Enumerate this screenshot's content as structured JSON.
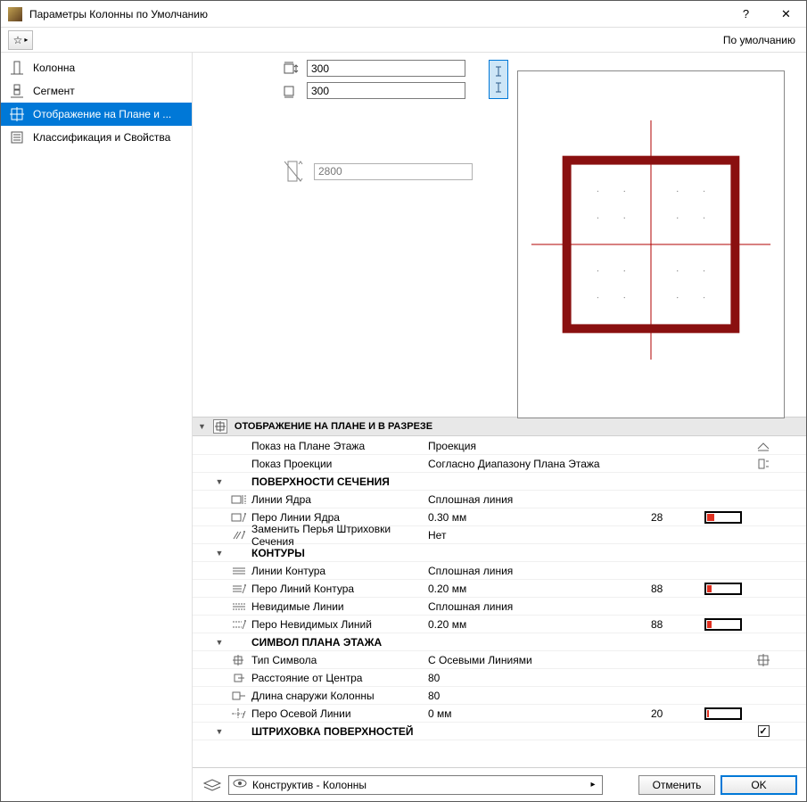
{
  "titlebar": {
    "title": "Параметры Колонны по Умолчанию"
  },
  "toolbar": {
    "default_label": "По умолчанию"
  },
  "sidebar": {
    "items": [
      {
        "label": "Колонна"
      },
      {
        "label": "Сегмент"
      },
      {
        "label": "Отображение на Плане и ..."
      },
      {
        "label": "Классификация и Свойства"
      }
    ]
  },
  "dims": {
    "width": "300",
    "depth": "300",
    "height": "2800"
  },
  "section": {
    "title": "ОТОБРАЖЕНИЕ НА ПЛАНЕ И В РАЗРЕЗЕ"
  },
  "rows": {
    "plan_show_label": "Показ на Плане Этажа",
    "plan_show_value": "Проекция",
    "proj_show_label": "Показ Проекции",
    "proj_show_value": "Согласно Диапазону Плана Этажа",
    "group_surfaces": "ПОВЕРХНОСТИ СЕЧЕНИЯ",
    "core_lines_label": "Линии Ядра",
    "core_lines_value": "Сплошная линия",
    "core_pen_label": "Перо Линии Ядра",
    "core_pen_value": "0.30 мм",
    "core_pen_num": "28",
    "override_label": "Заменить Перья Штриховки Сечения",
    "override_value": "Нет",
    "group_contours": "КОНТУРЫ",
    "contour_lines_label": "Линии Контура",
    "contour_lines_value": "Сплошная линия",
    "contour_pen_label": "Перо Линий Контура",
    "contour_pen_value": "0.20 мм",
    "contour_pen_num": "88",
    "hidden_lines_label": "Невидимые Линии",
    "hidden_lines_value": "Сплошная линия",
    "hidden_pen_label": "Перо Невидимых Линий",
    "hidden_pen_value": "0.20 мм",
    "hidden_pen_num": "88",
    "group_symbol": "СИМВОЛ ПЛАНА ЭТАЖА",
    "sym_type_label": "Тип Символа",
    "sym_type_value": "С Осевыми Линиями",
    "center_dist_label": "Расстояние от Центра",
    "center_dist_value": "80",
    "outside_len_label": "Длина снаружи Колонны",
    "outside_len_value": "80",
    "axis_pen_label": "Перо Осевой Линии",
    "axis_pen_value": "0 мм",
    "axis_pen_num": "20",
    "group_hatch": "ШТРИХОВКА ПОВЕРХНОСТЕЙ"
  },
  "bottombar": {
    "layer": "Конструктив - Колонны",
    "cancel": "Отменить",
    "ok": "OK"
  },
  "chart_data": null
}
